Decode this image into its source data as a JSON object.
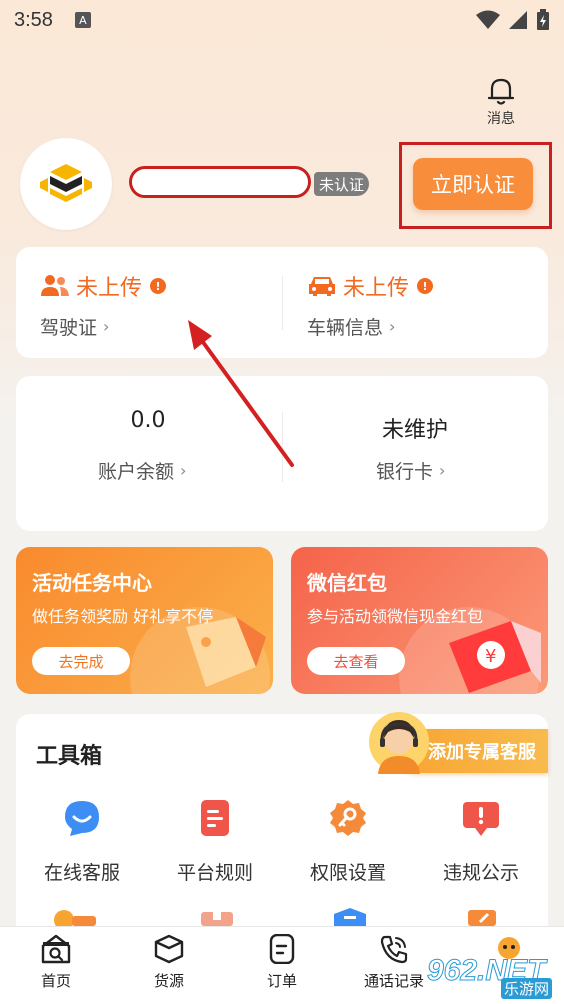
{
  "status_bar": {
    "time": "3:58",
    "notification_icon": "A"
  },
  "header": {
    "message_label": "消息",
    "cert_status": "未认证",
    "verify_button": "立即认证"
  },
  "uploads": [
    {
      "status": "未上传",
      "label": "驾驶证",
      "icon": "people-icon"
    },
    {
      "status": "未上传",
      "label": "车辆信息",
      "icon": "car-icon"
    }
  ],
  "account": [
    {
      "value": "0.0",
      "label": "账户余额"
    },
    {
      "value": "未维护",
      "label": "银行卡"
    }
  ],
  "promos": [
    {
      "title": "活动任务中心",
      "subtitle": "做任务领奖励 好礼享不停",
      "button": "去完成"
    },
    {
      "title": "微信红包",
      "subtitle": "参与活动领微信现金红包",
      "button": "去查看"
    }
  ],
  "toolbox": {
    "title": "工具箱",
    "service_button": "添加专属客服",
    "tools": [
      {
        "label": "在线客服",
        "icon": "chat-bubble-icon"
      },
      {
        "label": "平台规则",
        "icon": "document-icon"
      },
      {
        "label": "权限设置",
        "icon": "gear-key-icon"
      },
      {
        "label": "违规公示",
        "icon": "alert-board-icon"
      }
    ]
  },
  "tabs": [
    {
      "label": "首页",
      "icon": "home-search-icon"
    },
    {
      "label": "货源",
      "icon": "box-icon"
    },
    {
      "label": "订单",
      "icon": "order-icon"
    },
    {
      "label": "通话记录",
      "icon": "phone-icon"
    }
  ],
  "watermark": {
    "brand": "962.NET",
    "sub": "乐游网"
  },
  "colors": {
    "accent": "#f88d3b",
    "alert": "#f26a22",
    "annotation": "#c8201e"
  }
}
